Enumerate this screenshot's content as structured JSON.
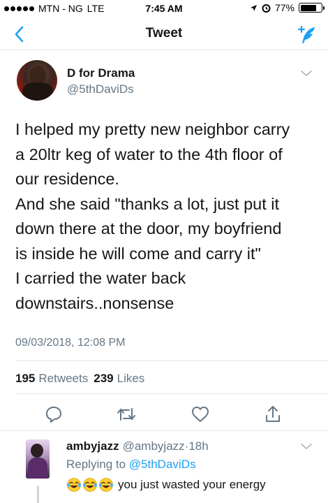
{
  "status_bar": {
    "carrier": "MTN - NG",
    "network": "LTE",
    "time": "7:45 AM",
    "battery": "77%",
    "battery_level": 0.77
  },
  "nav": {
    "title": "Tweet"
  },
  "tweet": {
    "author_name": "D for Drama",
    "author_handle": "@5thDaviDs",
    "text_lines": [
      "I helped my pretty new neighbor carry",
      "a 20ltr keg of water to the 4th floor of",
      "our residence.",
      "And she said \"thanks a lot, just put it",
      "down there at the door, my boyfriend",
      "is inside he will come and carry it\"",
      "I carried the water back",
      "downstairs..nonsense"
    ],
    "timestamp": "09/03/2018, 12:08 PM",
    "retweets_count": "195",
    "retweets_label": "Retweets",
    "likes_count": "239",
    "likes_label": "Likes"
  },
  "reply": {
    "name": "ambyjazz",
    "handle": "@ambyjazz",
    "separator": "·",
    "time": "18h",
    "replying_prefix": "Replying to",
    "replying_to": "@5thDaviDs",
    "text": "you just wasted your energy",
    "emoji": "face-with-tears-of-joy",
    "emoji_count": 3
  },
  "colors": {
    "accent": "#1da1f2",
    "muted": "#657786",
    "text": "#14171a",
    "divider": "#e1e8ed"
  },
  "icons": {
    "back": "chevron-left-icon",
    "compose": "compose-tweet-icon",
    "caret": "chevron-down-icon",
    "reply": "reply-icon",
    "retweet": "retweet-icon",
    "like": "heart-icon",
    "share": "share-icon"
  }
}
